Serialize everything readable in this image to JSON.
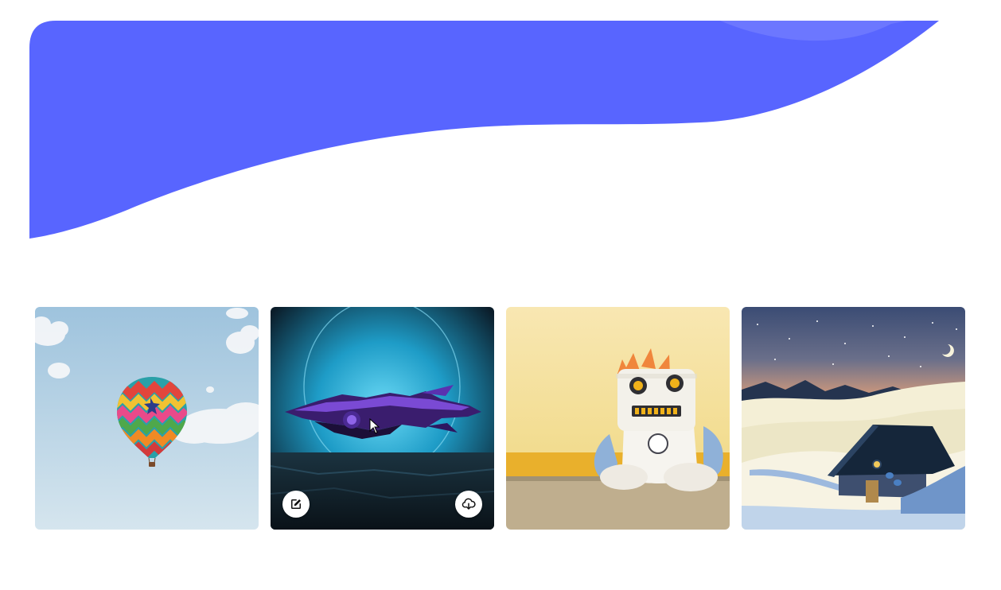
{
  "colors": {
    "hero_wave": "#5865FF",
    "hero_wave_highlight": "#6C77FF",
    "page_background": "#FFFFFF",
    "button_background": "#FFFFFF",
    "button_icon": "#111111"
  },
  "gallery": {
    "tiles": [
      {
        "subject": "hot-air-balloon",
        "hovered": false
      },
      {
        "subject": "purple-spaceship",
        "hovered": true,
        "actions": [
          {
            "icon": "edit-icon"
          },
          {
            "icon": "cloud-download-icon"
          }
        ]
      },
      {
        "subject": "plush-robot",
        "hovered": false
      },
      {
        "subject": "snowy-cabin",
        "hovered": false
      }
    ]
  }
}
